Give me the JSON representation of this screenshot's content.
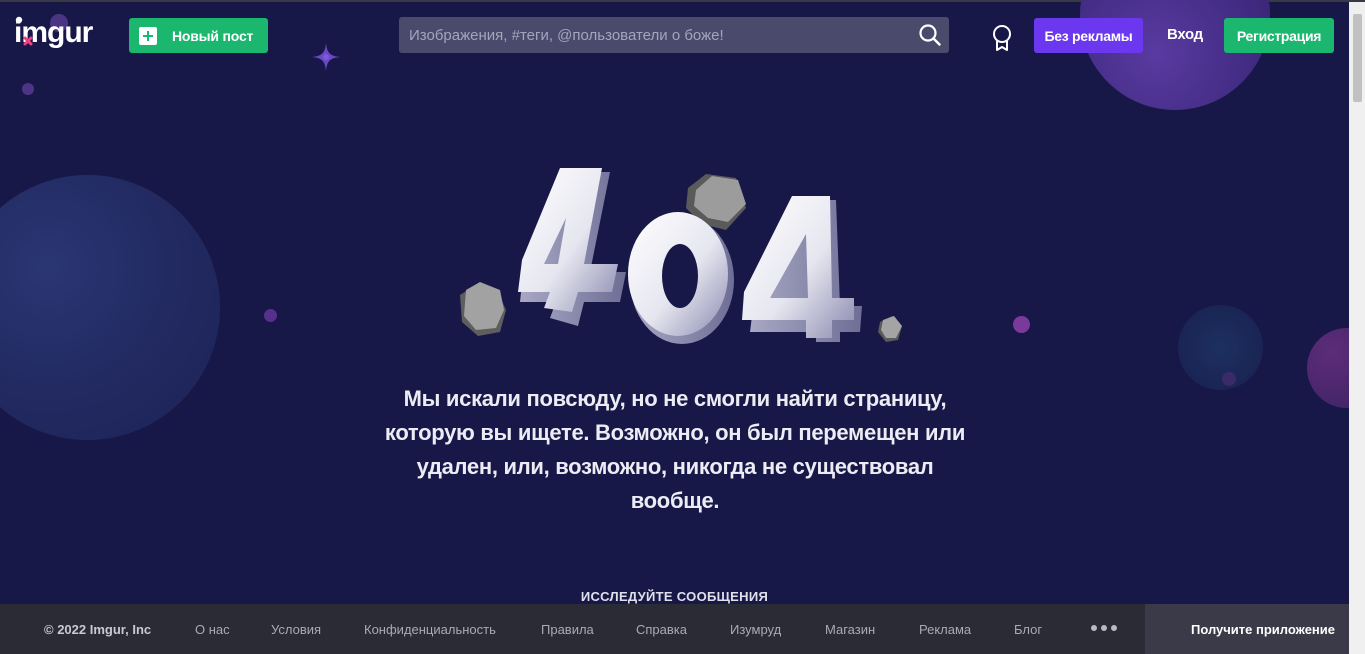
{
  "header": {
    "logo_text": "imgur",
    "new_post_label": "Новый пост",
    "search_placeholder": "Изображения, #теги, @пользователи о боже!",
    "no_ads_label": "Без рекламы",
    "login_label": "Вход",
    "register_label": "Регистрация"
  },
  "main": {
    "error_code": "404",
    "message": "Мы искали повсюду, но не смогли найти страницу, которую вы ищете. Возможно, он был перемещен или удален, или, возможно, никогда не существовал вообще.",
    "explore_label": "ИССЛЕДУЙТЕ СООБЩЕНИЯ"
  },
  "footer": {
    "copyright": "© 2022 Imgur, Inc",
    "links": [
      "О нас",
      "Условия",
      "Конфиденциальность",
      "Правила",
      "Справка",
      "Изумруд",
      "Магазин",
      "Реклама",
      "Блог"
    ],
    "more_icon": "ellipsis-icon",
    "get_app_label": "Получите приложение"
  },
  "colors": {
    "background": "#181848",
    "green": "#1bb76e",
    "purple": "#6b38ef",
    "footer": "#2b2b36"
  }
}
